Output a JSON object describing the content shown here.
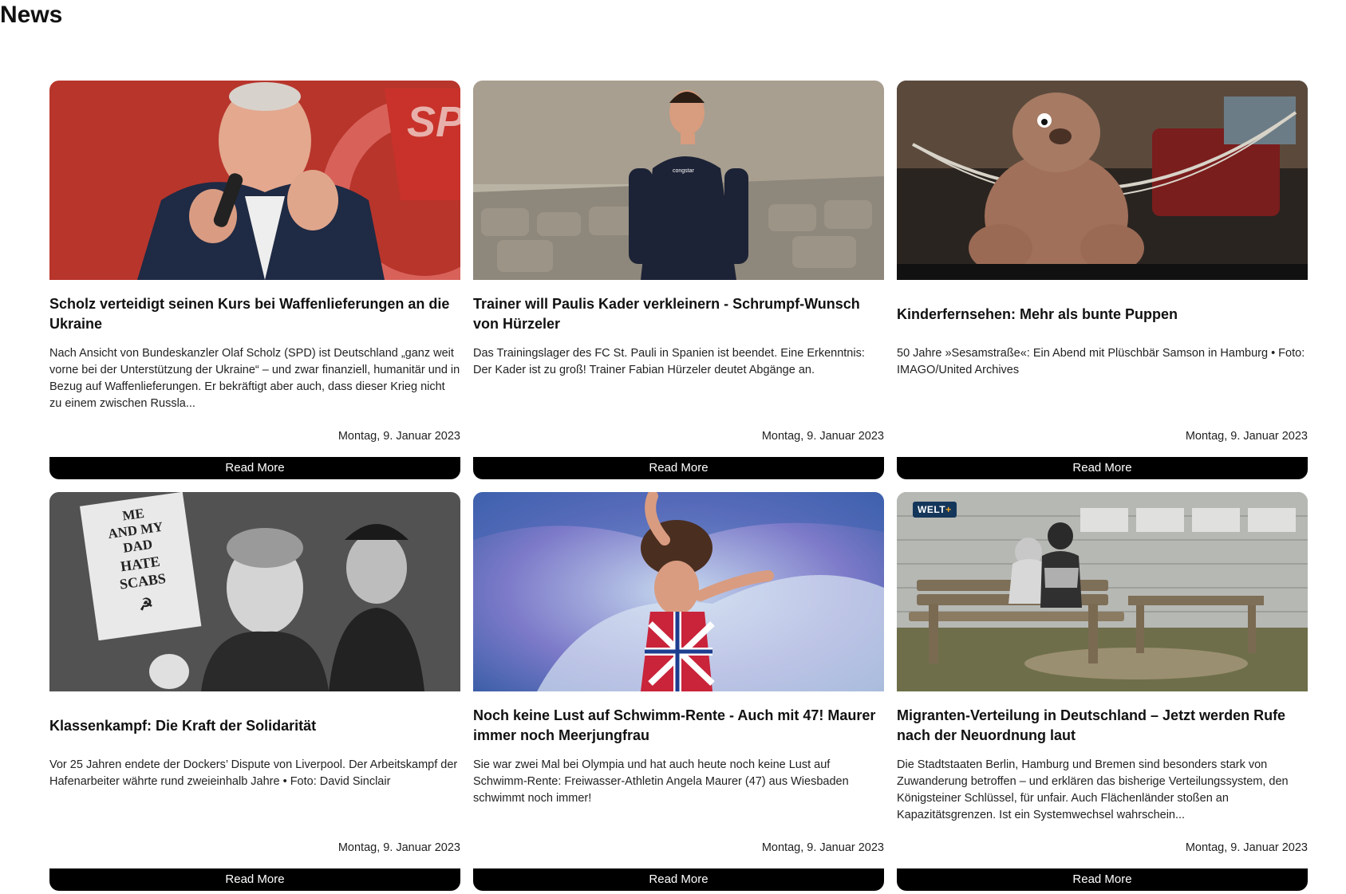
{
  "page": {
    "title": "News"
  },
  "articles": [
    {
      "title": "Scholz verteidigt seinen Kurs bei Waffenlieferungen an die Ukraine",
      "description": "Nach Ansicht von Bundeskanzler Olaf Scholz (SPD) ist Deutschland „ganz weit vorne bei der Unterstützung der Ukraine“ – und zwar finanziell, humanitär und in Bezug auf Waffenlieferungen. Er bekräftigt aber auch, dass dieser Krieg nicht zu einem zwischen Russla...",
      "date": "Montag, 9. Januar 2023",
      "button": "Read More",
      "image_text": "SPD"
    },
    {
      "title": "Trainer will Paulis Kader verkleinern - Schrumpf-Wunsch von Hürzeler",
      "description": "Das Trainingslager des FC St. Pauli in Spanien ist beendet. Eine Erkenntnis: Der Kader ist zu groß! Trainer Fabian Hürzeler deutet Abgänge an.",
      "date": "Montag, 9. Januar 2023",
      "button": "Read More",
      "image_text": "congstar"
    },
    {
      "title": "Kinderfernsehen: Mehr als bunte Puppen",
      "description": "50 Jahre »Sesamstraße«: Ein Abend mit Plüschbär Samson in Hamburg • Foto: IMAGO/United Archives",
      "date": "Montag, 9. Januar 2023",
      "button": "Read More"
    },
    {
      "title": "Klassenkampf: Die Kraft der Solidarität",
      "description": "Vor 25 Jahren endete der Dockers’ Dispute von Liverpool. Der Arbeitskampf der Hafenarbeiter währte rund zweieinhalb Jahre • Foto: David Sinclair",
      "date": "Montag, 9. Januar 2023",
      "button": "Read More",
      "image_sign": [
        "ME",
        "AND MY",
        "DAD",
        "HATE",
        "SCABS"
      ]
    },
    {
      "title": "Noch keine Lust auf Schwimm-Rente - Auch mit 47! Maurer immer noch Meerjungfrau",
      "description": "Sie war zwei Mal bei Olympia und hat auch heute noch keine Lust auf Schwimm-Rente: Freiwasser-Athletin Angela Maurer (47) aus Wiesbaden schwimmt noch immer!",
      "date": "Montag, 9. Januar 2023",
      "button": "Read More"
    },
    {
      "title": "Migranten-Verteilung in Deutschland – Jetzt werden Rufe nach der Neuordnung laut",
      "description": "Die Stadtstaaten Berlin, Hamburg und Bremen sind besonders stark von Zuwanderung betroffen – und erklären das bisherige Verteilungssystem, den Königsteiner Schlüssel, für unfair. Auch Flächenländer stoßen an Kapazitätsgrenzen. Ist ein Systemwechsel wahrschein...",
      "date": "Montag, 9. Januar 2023",
      "button": "Read More",
      "badge_main": "WELT",
      "badge_plus": "+"
    }
  ]
}
